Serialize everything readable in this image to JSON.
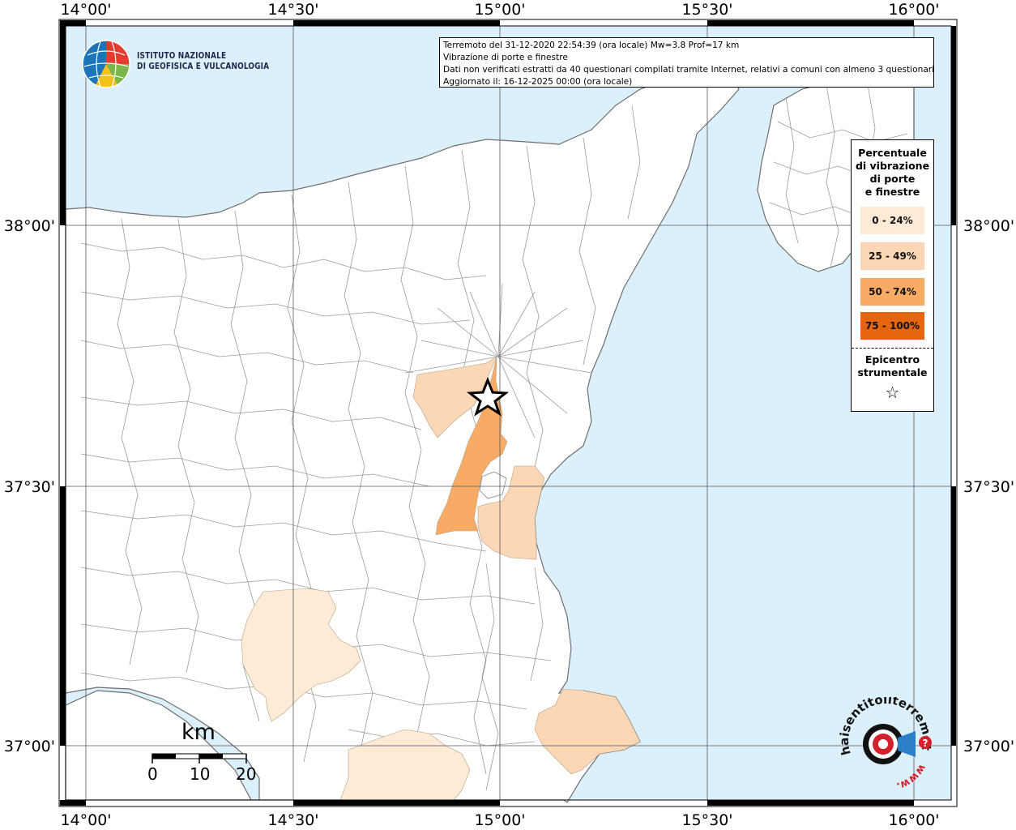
{
  "info": {
    "line1": "Terremoto del 31-12-2020 22:54:39 (ora locale) Mw=3.8 Prof=17 km",
    "line2": "Vibrazione di porte e finestre",
    "line3": "Dati non verificati estratti da 40 questionari compilati tramite Internet, relativi a comuni con almeno 3 questionari.",
    "line4": "Aggiornato il: 16-12-2025 00:00 (ora locale)"
  },
  "logo": {
    "line1": "ISTITUTO NAZIONALE",
    "line2": "DI GEOFISICA E VULCANOLOGIA"
  },
  "legend": {
    "title_lines": [
      "Percentuale",
      "di vibrazione",
      "di porte",
      "e finestre"
    ],
    "classes": [
      {
        "label": "0 - 24%",
        "color": "#fdebd6"
      },
      {
        "label": "25 - 49%",
        "color": "#fcd7b6"
      },
      {
        "label": "50 - 74%",
        "color": "#f7ab65"
      },
      {
        "label": "75 - 100%",
        "color": "#e66511"
      }
    ],
    "epicenter_line1": "Epicentro",
    "epicenter_line2": "strumentale"
  },
  "axes": {
    "lon_labels": [
      "14°00'",
      "14°30'",
      "15°00'",
      "15°30'",
      "16°00'"
    ],
    "lat_labels": [
      "38°00'",
      "37°30'",
      "37°00'"
    ]
  },
  "scale": {
    "unit": "km",
    "labels": [
      "0",
      "10",
      "20"
    ]
  },
  "website_logo": {
    "text": "haisentitoilterremoto.it",
    "prefix": "www."
  },
  "colors": {
    "sea": "#dcf0fb",
    "land": "#ffffff",
    "boundary": "#8c8c8c",
    "grid": "#555555"
  }
}
